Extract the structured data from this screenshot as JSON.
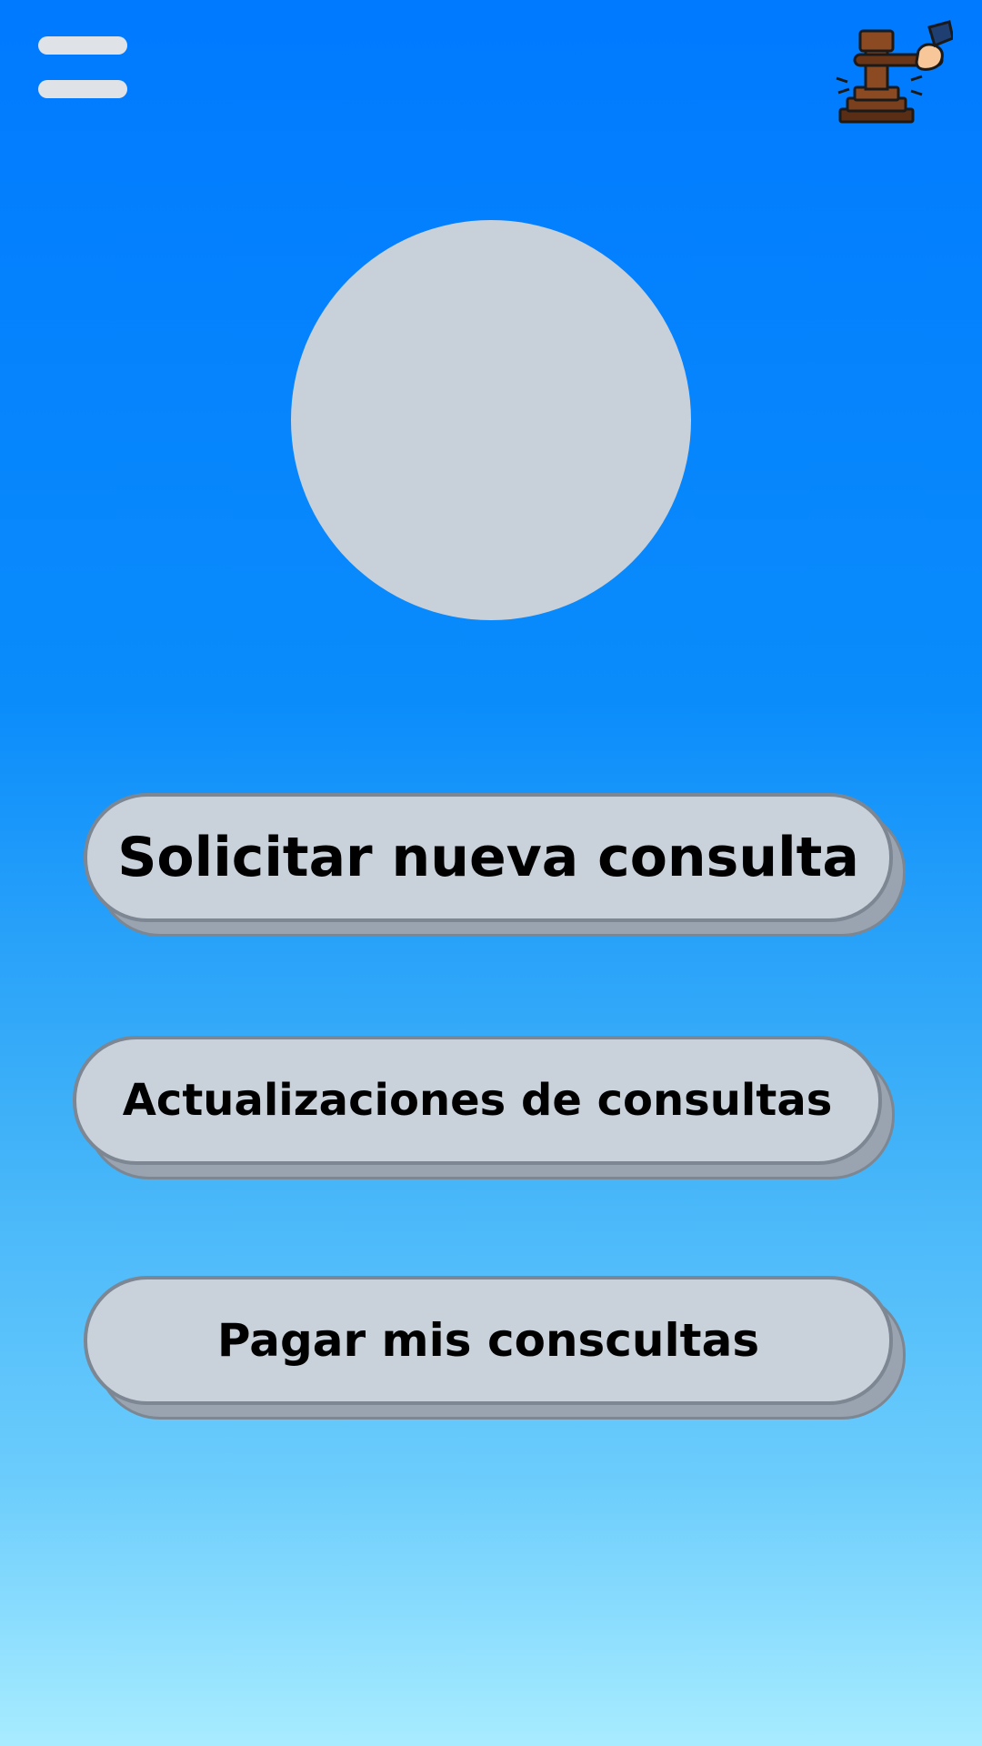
{
  "header": {
    "menu_icon": "hamburger-menu-icon",
    "logo_icon": "gavel-hand-icon"
  },
  "profile": {
    "avatar": "avatar-placeholder"
  },
  "actions": [
    {
      "label": "Solicitar nueva consulta"
    },
    {
      "label": "Actualizaciones de consultas"
    },
    {
      "label": "Pagar mis conscultas"
    }
  ],
  "colors": {
    "background_top": "#007aff",
    "background_bottom": "#a8ecff",
    "button_fill": "#c9d1db",
    "button_border": "#7c8793",
    "avatar_fill": "#c8d0da"
  }
}
